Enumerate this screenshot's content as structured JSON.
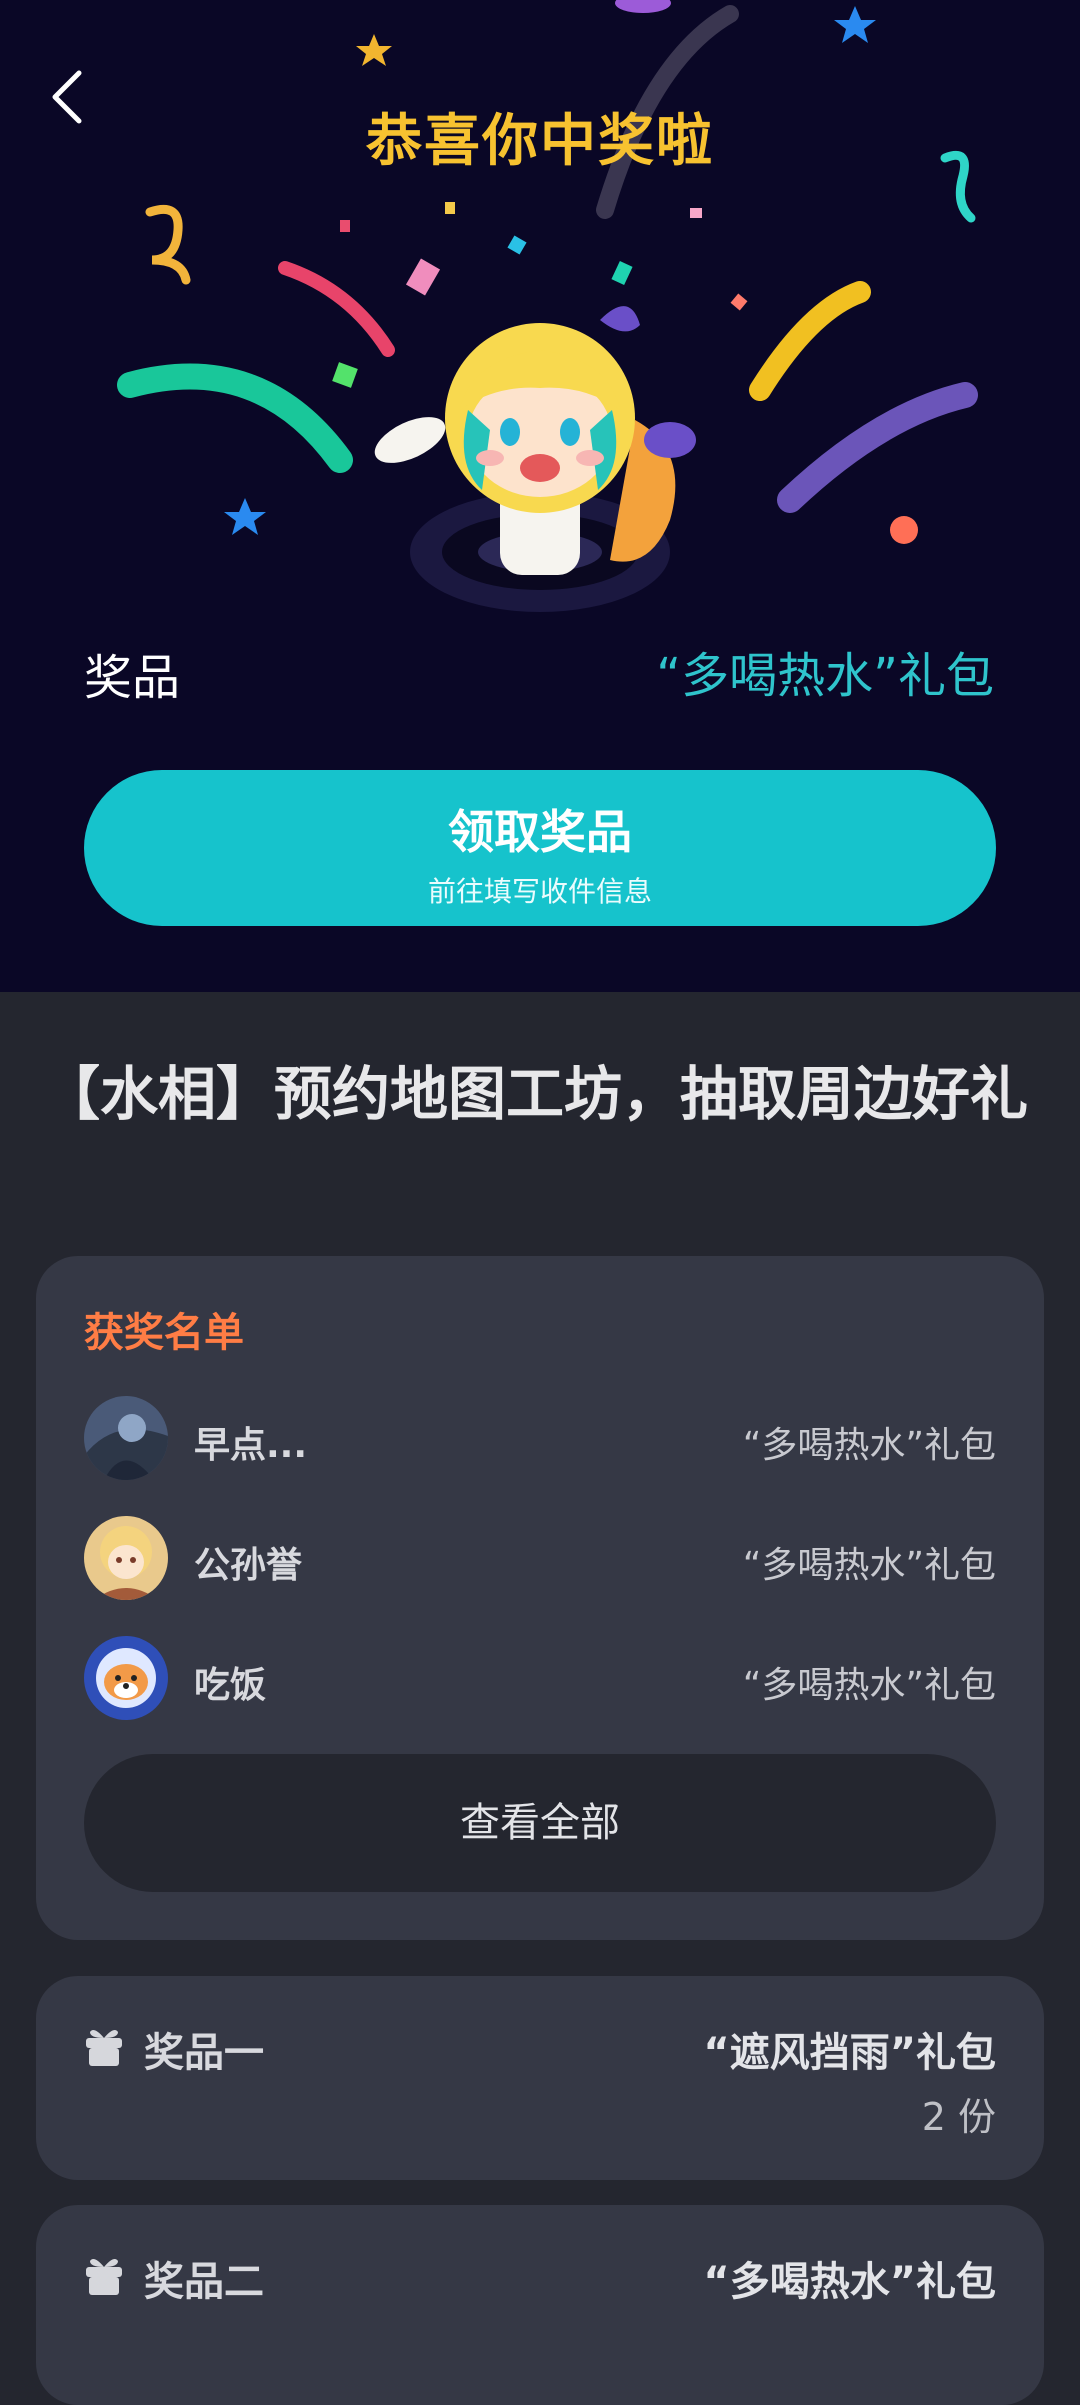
{
  "header": {
    "title": "恭喜你中奖啦",
    "back_icon": "chevron-left-icon"
  },
  "result": {
    "prize_label": "奖品",
    "prize_value": "“多喝热水”礼包"
  },
  "claim_button": {
    "label": "领取奖品",
    "sublabel": "前往填写收件信息"
  },
  "event": {
    "title": "【水相】预约地图工坊，抽取周边好礼"
  },
  "winners": {
    "heading": "获奖名单",
    "items": [
      {
        "name": "早点...",
        "prize": "“多喝热水”礼包"
      },
      {
        "name": "公孙誉",
        "prize": "“多喝热水”礼包"
      },
      {
        "name": "吃饭",
        "prize": "“多喝热水”礼包"
      }
    ],
    "view_all_label": "查看全部"
  },
  "prizes": [
    {
      "tier": "奖品一",
      "name": "“遮风挡雨”礼包",
      "quantity": "2 份",
      "icon": "gift-icon"
    },
    {
      "tier": "奖品二",
      "name": "“多喝热水”礼包",
      "icon": "gift-icon"
    }
  ],
  "colors": {
    "hero_bg": "#0a0726",
    "title_gold": "#f7c230",
    "accent_teal": "#16c3cc",
    "winners_heading": "#ff7d45",
    "card_bg": "#353845",
    "page_bg": "#24262f"
  }
}
